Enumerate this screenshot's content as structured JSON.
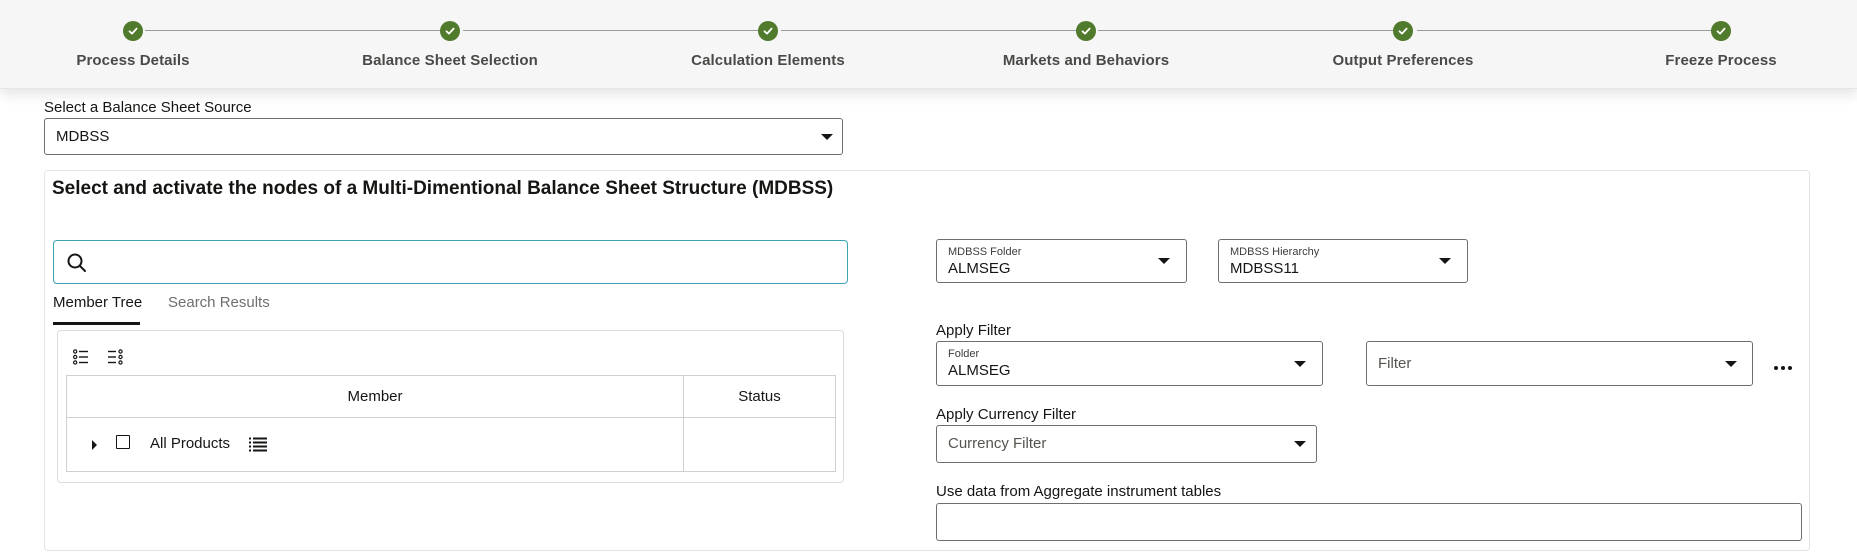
{
  "stepper": {
    "steps": [
      {
        "label": "Process Details",
        "status": "complete"
      },
      {
        "label": "Balance Sheet Selection",
        "status": "complete"
      },
      {
        "label": "Calculation Elements",
        "status": "complete"
      },
      {
        "label": "Markets and Behaviors",
        "status": "complete"
      },
      {
        "label": "Output Preferences",
        "status": "complete"
      },
      {
        "label": "Freeze Process",
        "status": "complete"
      }
    ]
  },
  "source": {
    "label": "Select a Balance Sheet Source",
    "value": "MDBSS"
  },
  "panel": {
    "title": "Select and activate the nodes of a Multi-Dimentional Balance Sheet Structure (MDBSS)"
  },
  "search": {
    "value": "",
    "placeholder": ""
  },
  "tabs": {
    "member_tree": "Member Tree",
    "search_results": "Search Results",
    "active": "Member Tree"
  },
  "tree": {
    "toolbar_icons": [
      "expand-all-icon",
      "collapse-all-icon"
    ],
    "columns": {
      "member": "Member",
      "status": "Status"
    },
    "rows": [
      {
        "member": "All Products",
        "status": "",
        "expanded": false,
        "checked": false
      }
    ]
  },
  "mdbss_folder": {
    "label": "MDBSS Folder",
    "value": "ALMSEG"
  },
  "mdbss_hierarchy": {
    "label": "MDBSS Hierarchy",
    "value": "MDBSS11"
  },
  "apply_filter": {
    "label": "Apply Filter",
    "folder": {
      "label": "Folder",
      "value": "ALMSEG"
    },
    "filter": {
      "placeholder": "Filter"
    }
  },
  "currency_filter": {
    "label": "Apply Currency Filter",
    "placeholder": "Currency Filter"
  },
  "aggregate": {
    "label": "Use data from Aggregate instrument tables",
    "value": ""
  },
  "colors": {
    "step_complete": "#507a2c",
    "focus_border": "#3aa3b5"
  }
}
